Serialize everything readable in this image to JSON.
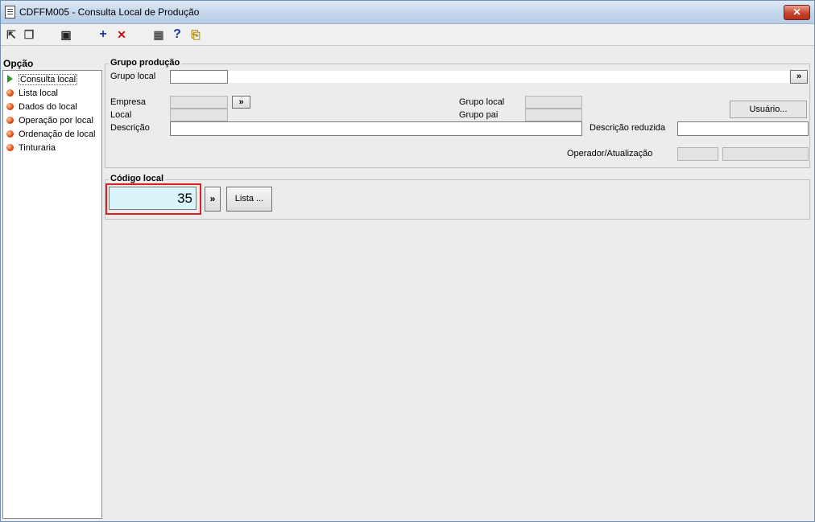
{
  "window": {
    "title": "CDFFM005 - Consulta Local de Produção",
    "close_glyph": "✕"
  },
  "toolbar": {
    "items": [
      {
        "icon": "arrow-icon",
        "glyph": "⇱"
      },
      {
        "icon": "windows-icon",
        "glyph": "❐"
      },
      {
        "icon": "save-icon",
        "glyph": "▣"
      },
      {
        "icon": "add-icon",
        "glyph": "+"
      },
      {
        "icon": "delete-icon",
        "glyph": "✕"
      },
      {
        "icon": "calendar-icon",
        "glyph": "▦"
      },
      {
        "icon": "help-icon",
        "glyph": "?"
      },
      {
        "icon": "exit-icon",
        "glyph": "⎘"
      }
    ]
  },
  "sidebar": {
    "title": "Opção",
    "items": [
      {
        "label": "Consulta local",
        "selected": true
      },
      {
        "label": "Lista local"
      },
      {
        "label": "Dados do local"
      },
      {
        "label": "Operação por local"
      },
      {
        "label": "Ordenação de local"
      },
      {
        "label": "Tinturaria"
      }
    ]
  },
  "grupo_producao": {
    "title": "Grupo produção",
    "grupo_local_label": "Grupo local",
    "grupo_local_value": "",
    "lookup_glyph": "»",
    "empresa_label": "Empresa",
    "local_label": "Local",
    "descricao_label": "Descrição",
    "grupo_local2_label": "Grupo local",
    "grupo_pai_label": "Grupo pai",
    "usuario_button": "Usuário...",
    "descricao_reduzida_label": "Descrição reduzida",
    "operador_label": "Operador/Atualização"
  },
  "codigo_local": {
    "title": "Código local",
    "value": "35",
    "lookup_glyph": "»",
    "lista_button": "Lista ..."
  },
  "colors": {
    "accent_red": "#e02020",
    "input_highlight": "#d9f5fa"
  }
}
